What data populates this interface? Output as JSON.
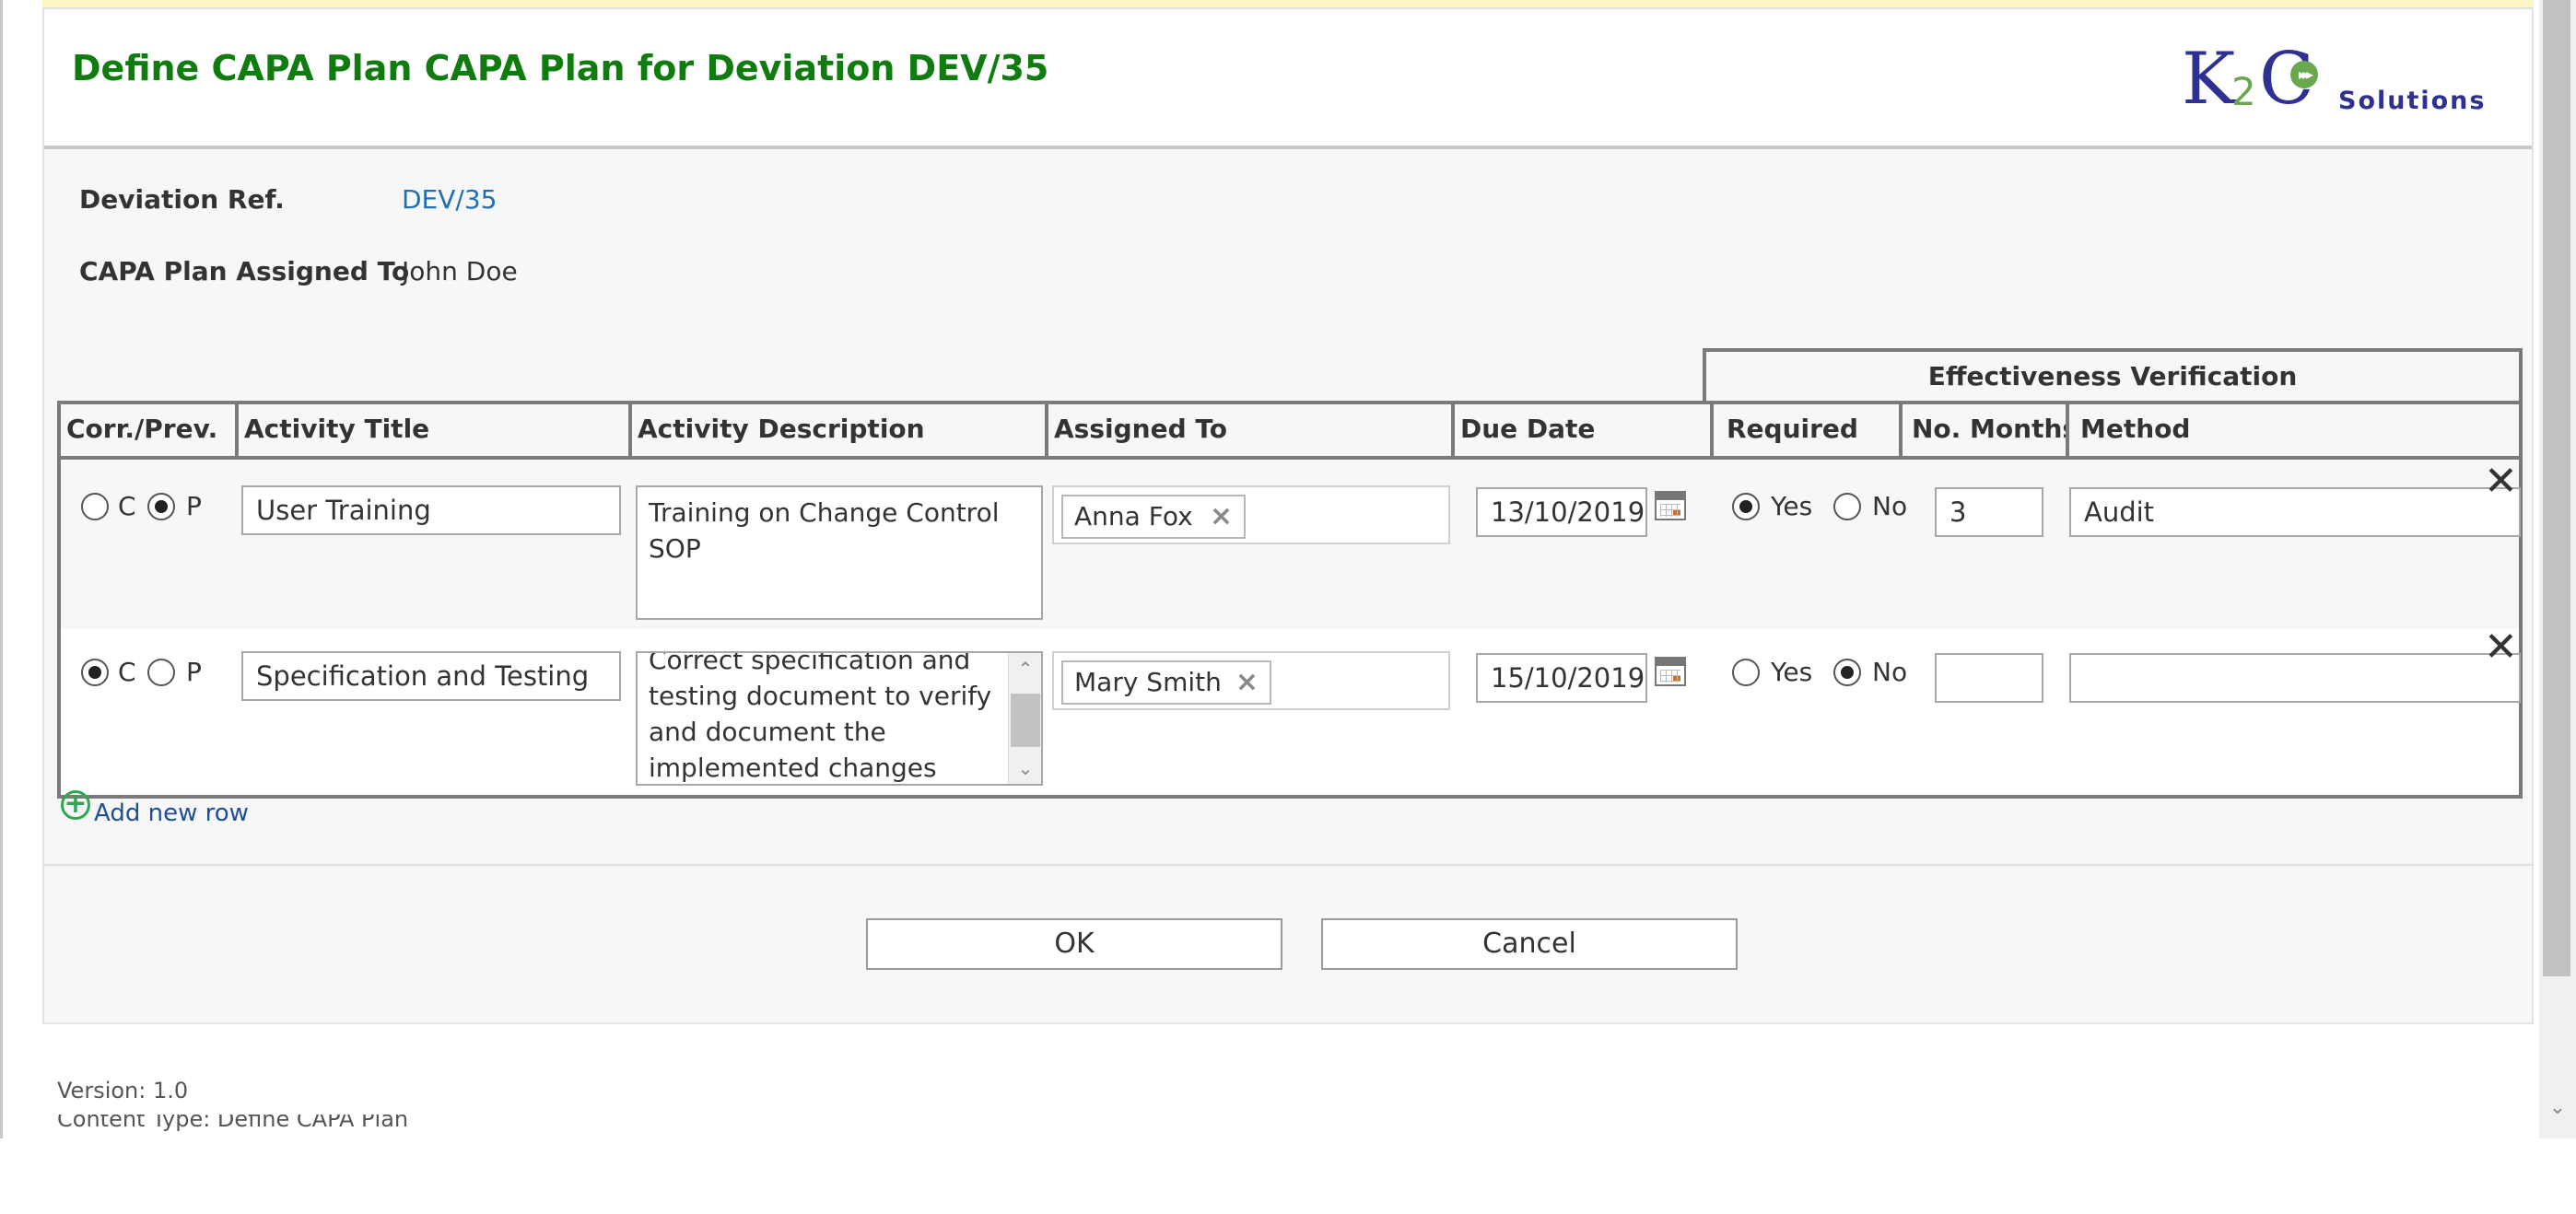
{
  "header": {
    "title": "Define CAPA Plan CAPA Plan for Deviation DEV/35",
    "logo": {
      "k": "K",
      "two": "2",
      "c": "C",
      "solutions": "Solutions"
    }
  },
  "meta": {
    "deviation_ref_label": "Deviation Ref.",
    "deviation_ref_value": "DEV/35",
    "assigned_label": "CAPA Plan Assigned To",
    "assigned_value": "John Doe"
  },
  "grid": {
    "group_header": "Effectiveness Verification",
    "columns": {
      "corr_prev": "Corr./Prev.",
      "activity_title": "Activity Title",
      "activity_description": "Activity Description",
      "assigned_to": "Assigned To",
      "due_date": "Due Date",
      "required": "Required",
      "no_months": "No. Months",
      "method": "Method"
    },
    "radio_labels": {
      "c": "C",
      "p": "P",
      "yes": "Yes",
      "no": "No"
    },
    "rows": [
      {
        "type": "P",
        "title": "User Training",
        "description": "Training on Change Control SOP",
        "assignee": "Anna Fox",
        "due_date": "13/10/2019",
        "required": "Yes",
        "months": "3",
        "method": "Audit"
      },
      {
        "type": "C",
        "title": "Specification and Testing",
        "description": "Correct specification and testing document to verify and document the implemented changes",
        "assignee": "Mary Smith",
        "due_date": "15/10/2019",
        "required": "No",
        "months": "",
        "method": ""
      }
    ],
    "add_row_label": "Add new row"
  },
  "buttons": {
    "ok": "OK",
    "cancel": "Cancel"
  },
  "footer": {
    "version": "Version: 1.0",
    "content_type": "Content Type: Define CAPA Plan"
  },
  "colors": {
    "title_green": "#107c10",
    "logo_blue": "#2e3192",
    "link_blue": "#1f6fb5",
    "add_green": "#2ea84f"
  },
  "icons": {
    "calendar": "calendar-icon",
    "remove_row": "close-icon",
    "remove_person": "remove-icon",
    "add": "add-circle-icon"
  }
}
